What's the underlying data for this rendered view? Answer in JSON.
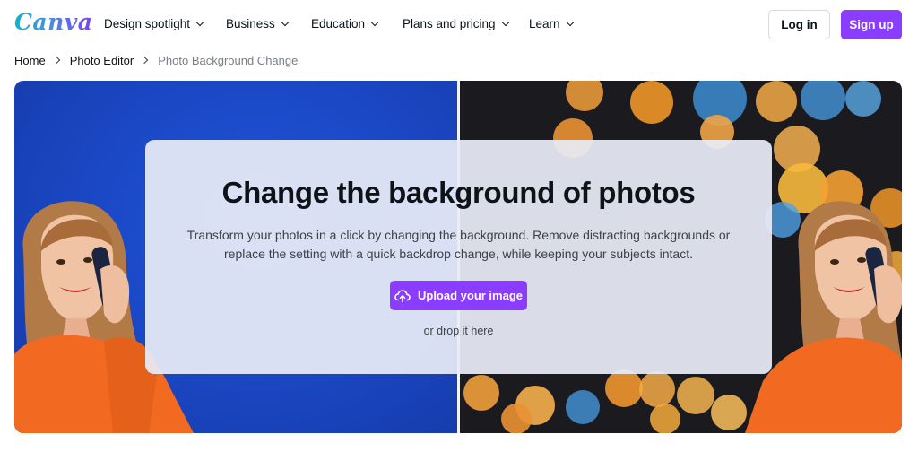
{
  "brand": {
    "logo_text": "Canva",
    "accent": "#8b3dff"
  },
  "nav": {
    "items": [
      {
        "label": "Design spotlight"
      },
      {
        "label": "Business"
      },
      {
        "label": "Education"
      },
      {
        "label": "Plans and pricing"
      },
      {
        "label": "Learn"
      }
    ],
    "login_label": "Log in",
    "signup_label": "Sign up"
  },
  "breadcrumb": {
    "home": "Home",
    "parent": "Photo Editor",
    "current": "Photo Background Change"
  },
  "hero": {
    "title": "Change the background of photos",
    "description": "Transform your photos in a click by changing the background. Remove distracting backgrounds or replace the setting with a quick backdrop change, while keeping your subjects intact.",
    "upload_label": "Upload your image",
    "drop_text": "or drop it here",
    "left_background": "#1a46c2",
    "right_background": "#1b1b1f"
  }
}
